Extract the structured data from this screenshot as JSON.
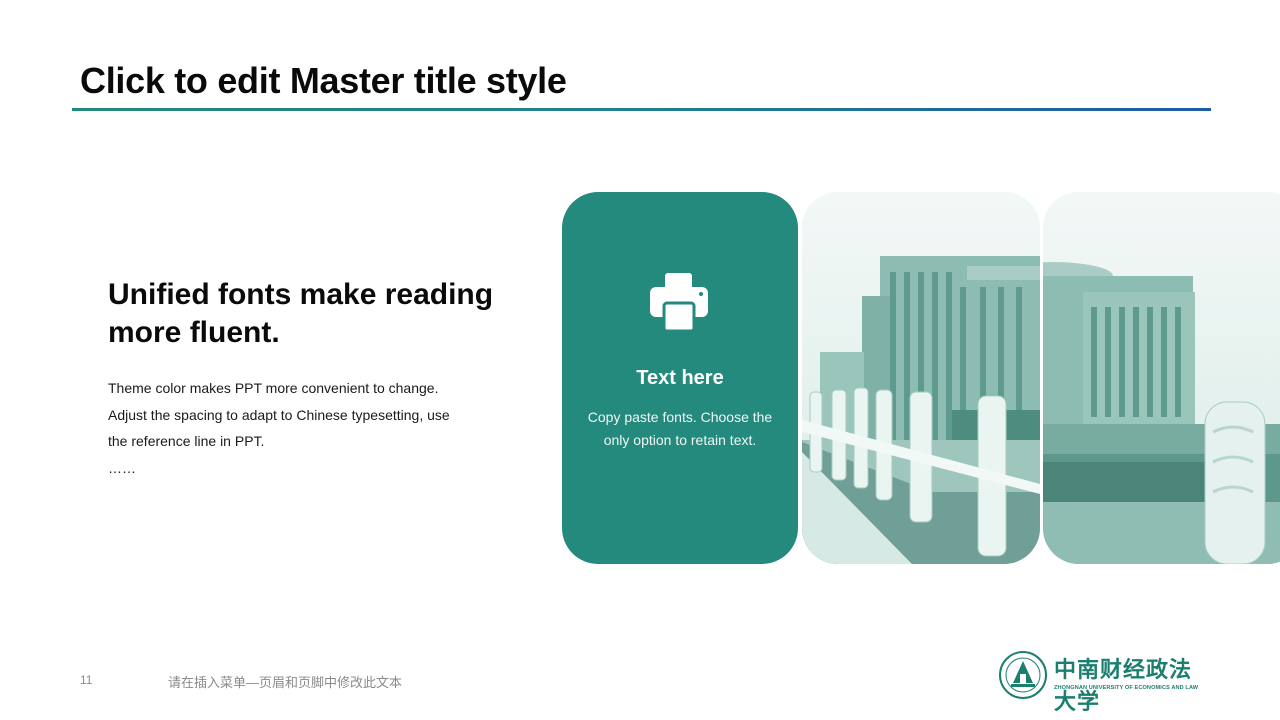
{
  "slide": {
    "title": "Click to edit Master title style",
    "heading": "Unified fonts make reading more fluent.",
    "body_lines": [
      "Theme color makes PPT more convenient to change.",
      "Adjust the spacing to adapt to Chinese typesetting, use the reference line in PPT.",
      "……"
    ]
  },
  "card": {
    "icon": "printer-icon",
    "title": "Text here",
    "text": "Copy paste fonts. Choose the only option to retain text."
  },
  "photos": [
    {
      "name": "campus-building-photo-left"
    },
    {
      "name": "campus-building-photo-right"
    }
  ],
  "footer": {
    "page_number": "11",
    "text": "请在插入菜单—页眉和页脚中修改此文本"
  },
  "logo": {
    "name_cn": "中南财经政法大学",
    "name_en": "ZHONGNAN UNIVERSITY OF ECONOMICS AND LAW"
  },
  "colors": {
    "accent": "#238a7d",
    "rule_start": "#1f8a7c",
    "rule_end": "#1d5aa8",
    "logo": "#1b7f6f"
  }
}
